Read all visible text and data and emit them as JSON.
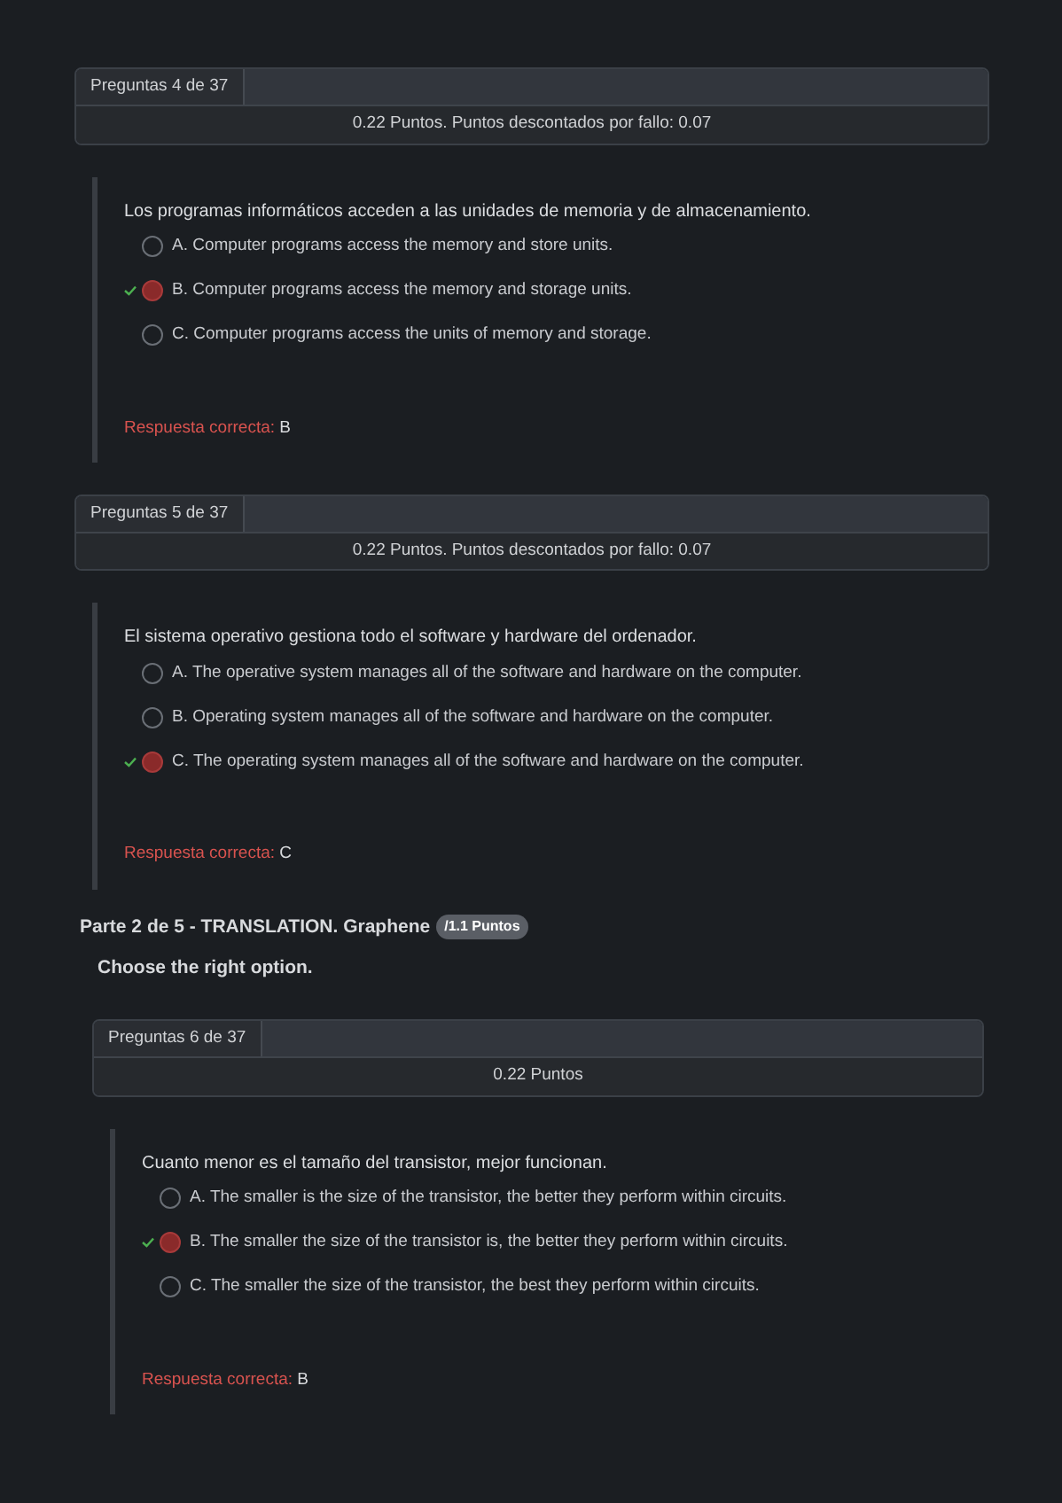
{
  "questions": [
    {
      "number": "Preguntas 4 de 37",
      "points": "0.22 Puntos. Puntos descontados por fallo: 0.07",
      "text": "Los programas informáticos acceden a las unidades de memoria y de almacenamiento.",
      "options": [
        {
          "label": "A. Computer programs access the memory and store units.",
          "selected": false,
          "correct": false
        },
        {
          "label": "B. Computer programs access the memory and storage units.",
          "selected": true,
          "correct": true
        },
        {
          "label": "C. Computer programs access the units of memory and storage.",
          "selected": false,
          "correct": false
        }
      ],
      "answer_label": "Respuesta correcta:",
      "answer": "B"
    },
    {
      "number": "Preguntas 5 de 37",
      "points": "0.22 Puntos. Puntos descontados por fallo: 0.07",
      "text": "El sistema operativo gestiona todo el software y hardware del ordenador.",
      "options": [
        {
          "label": "A. The operative system manages all of the software and hardware on the computer.",
          "selected": false,
          "correct": false
        },
        {
          "label": "B. Operating system manages all of the software and hardware on the computer.",
          "selected": false,
          "correct": false
        },
        {
          "label": "C. The operating system manages all of the software and hardware on the computer.",
          "selected": true,
          "correct": true
        }
      ],
      "answer_label": "Respuesta correcta:",
      "answer": "C"
    }
  ],
  "part": {
    "title": "Parte 2 de 5 - TRANSLATION. Graphene",
    "points": "/1.1 Puntos",
    "instruction": "Choose the right option.",
    "questions": [
      {
        "number": "Preguntas 6 de 37",
        "points": "0.22 Puntos",
        "text": "Cuanto menor es el tamaño del transistor, mejor funcionan.",
        "options": [
          {
            "label": "A. The smaller is the size of the transistor, the better they perform within circuits.",
            "selected": false,
            "correct": false
          },
          {
            "label": "B. The smaller the size of the transistor is, the better they perform within circuits.",
            "selected": true,
            "correct": true
          },
          {
            "label": "C. The smaller the size of the transistor, the best they perform within circuits.",
            "selected": false,
            "correct": false
          }
        ],
        "answer_label": "Respuesta correcta:",
        "answer": "B"
      }
    ]
  }
}
